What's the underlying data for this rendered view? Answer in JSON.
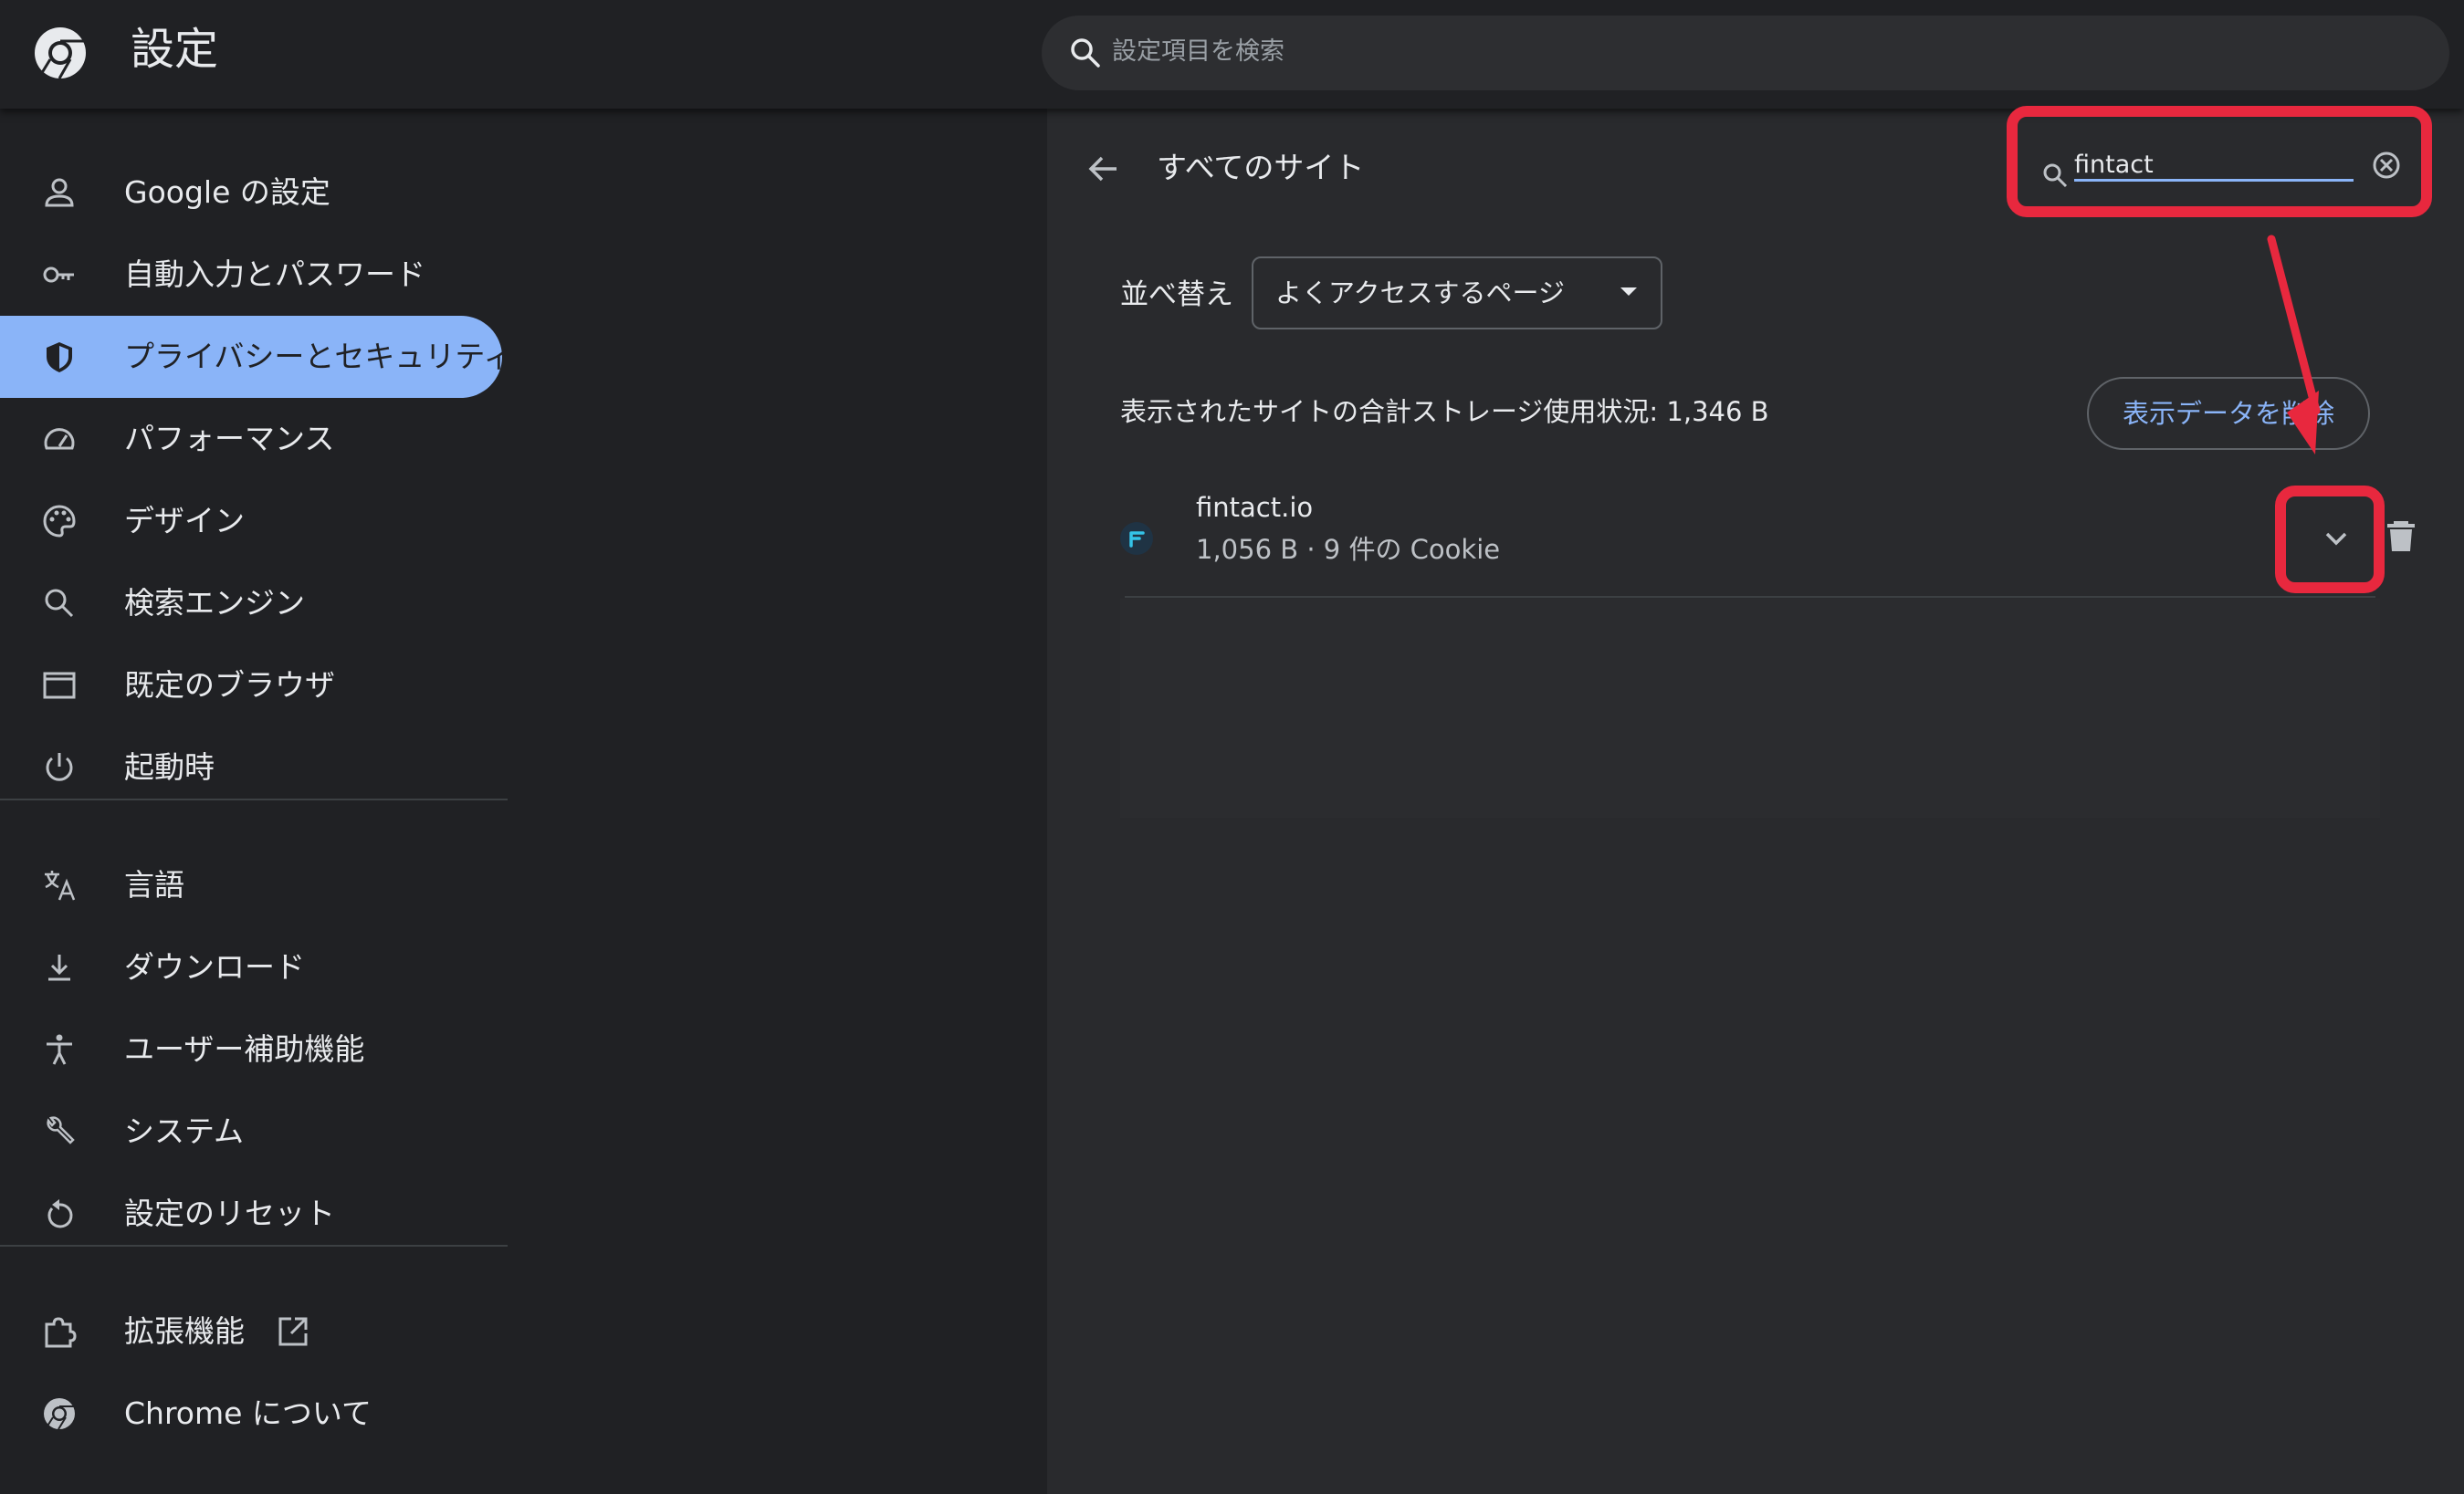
{
  "header": {
    "title": "設定",
    "search_placeholder": "設定項目を検索"
  },
  "sidebar": {
    "items": [
      {
        "label": "Google の設定",
        "icon": "person-icon"
      },
      {
        "label": "自動入力とパスワード",
        "icon": "key-icon"
      },
      {
        "label": "プライバシーとセキュリティ",
        "icon": "shield-icon",
        "active": true
      },
      {
        "label": "パフォーマンス",
        "icon": "speedometer-icon"
      },
      {
        "label": "デザイン",
        "icon": "palette-icon"
      },
      {
        "label": "検索エンジン",
        "icon": "search-icon"
      },
      {
        "label": "既定のブラウザ",
        "icon": "browser-window-icon"
      },
      {
        "label": "起動時",
        "icon": "power-icon"
      },
      {
        "label": "言語",
        "icon": "translate-icon"
      },
      {
        "label": "ダウンロード",
        "icon": "download-icon"
      },
      {
        "label": "ユーザー補助機能",
        "icon": "accessibility-icon"
      },
      {
        "label": "システム",
        "icon": "wrench-icon"
      },
      {
        "label": "設定のリセット",
        "icon": "reset-icon"
      },
      {
        "label": "拡張機能",
        "icon": "puzzle-icon"
      },
      {
        "label": "Chrome について",
        "icon": "chrome-icon"
      }
    ]
  },
  "main": {
    "title": "すべてのサイト",
    "filter_value": "fintact",
    "sort_label": "並べ替え",
    "sort_value": "よくアクセスするページ",
    "storage_text": "表示されたサイトの合計ストレージ使用状況: 1,346 B",
    "clear_button": "表示データを削除",
    "sites": [
      {
        "name": "fintact.io",
        "meta": "1,056 B · 9 件の Cookie"
      }
    ]
  },
  "colors": {
    "background": "#202124",
    "panel": "#292a2d",
    "accent": "#8ab4f8",
    "highlight": "#e8283e"
  }
}
